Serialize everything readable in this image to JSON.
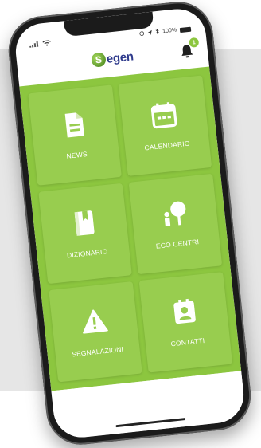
{
  "status_bar": {
    "right_text": "100%"
  },
  "header": {
    "logo_text": "egen",
    "logo_mark": "S",
    "notification_count": "1"
  },
  "tiles": [
    {
      "label": "NEWS",
      "icon": "document-icon"
    },
    {
      "label": "CALENDARIO",
      "icon": "calendar-icon"
    },
    {
      "label": "DIZIONARIO",
      "icon": "book-icon"
    },
    {
      "label": "ECO CENTRI",
      "icon": "tree-icon"
    },
    {
      "label": "SEGNALAZIONI",
      "icon": "warning-icon"
    },
    {
      "label": "CONTATTI",
      "icon": "contact-icon"
    }
  ],
  "colors": {
    "brand_green": "#8cc63f",
    "tile_green": "#98cd4f",
    "logo_blue": "#2e3a8c"
  }
}
